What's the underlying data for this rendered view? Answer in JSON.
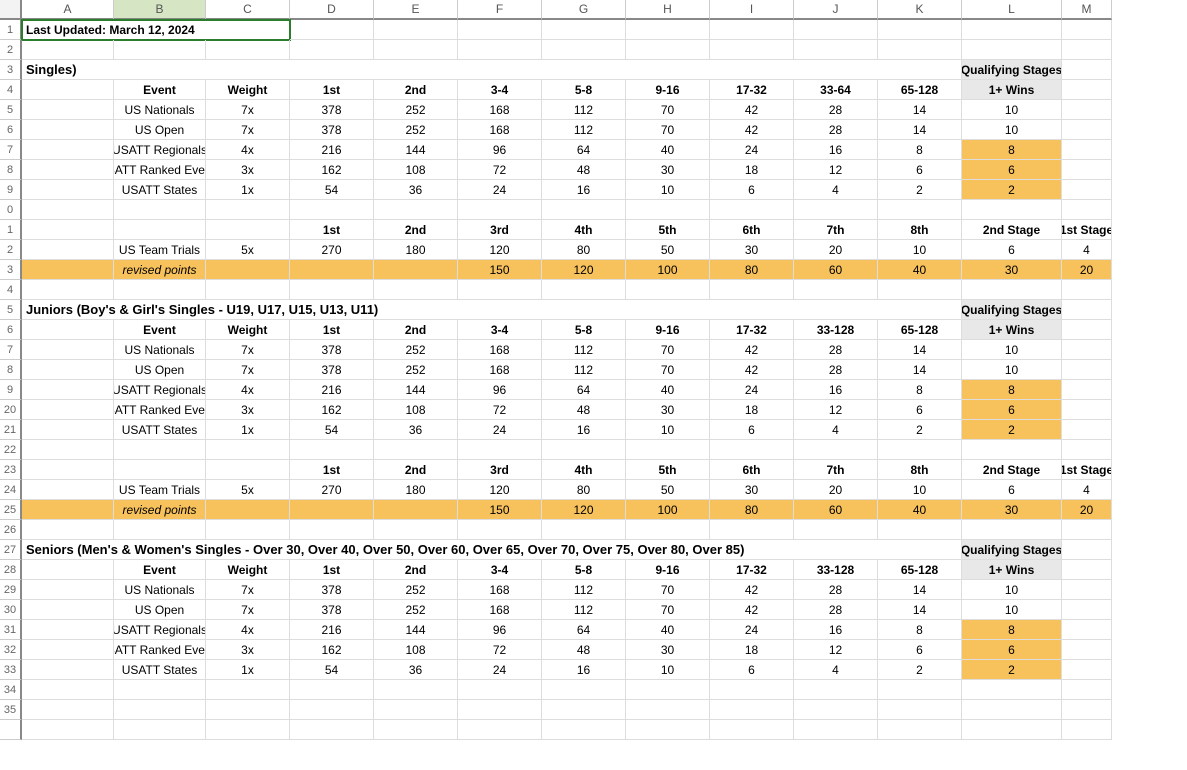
{
  "columns": [
    "A",
    "B",
    "C",
    "D",
    "E",
    "F",
    "G",
    "H",
    "I",
    "J",
    "K",
    "L",
    "M"
  ],
  "row_labels": [
    "1",
    "2",
    "3",
    "4",
    "5",
    "6",
    "7",
    "8",
    "9",
    "0",
    "1",
    "2",
    "3",
    "4",
    "5",
    "6",
    "7",
    "8",
    "9",
    "20",
    "21",
    "22",
    "23",
    "24",
    "25",
    "26",
    "27",
    "28",
    "29",
    "30",
    "31",
    "32",
    "33",
    "34",
    "35"
  ],
  "last_updated": "Last Updated: March 12, 2024",
  "section1": {
    "title": "Singles)",
    "qs_top": "Qualifying Stages",
    "headers": [
      "Event",
      "Weight",
      "1st",
      "2nd",
      "3-4",
      "5-8",
      "9-16",
      "17-32",
      "33-64",
      "65-128",
      "1+ Wins"
    ],
    "rows": [
      {
        "event": "US Nationals",
        "weight": "7x",
        "v": [
          "378",
          "252",
          "168",
          "112",
          "70",
          "42",
          "28",
          "14",
          "10"
        ],
        "hl": false
      },
      {
        "event": "US Open",
        "weight": "7x",
        "v": [
          "378",
          "252",
          "168",
          "112",
          "70",
          "42",
          "28",
          "14",
          "10"
        ],
        "hl": false
      },
      {
        "event": "USATT Regionals",
        "weight": "4x",
        "v": [
          "216",
          "144",
          "96",
          "64",
          "40",
          "24",
          "16",
          "8",
          "8"
        ],
        "hl": true
      },
      {
        "event": "USATT Ranked Events",
        "weight": "3x",
        "v": [
          "162",
          "108",
          "72",
          "48",
          "30",
          "18",
          "12",
          "6",
          "6"
        ],
        "hl": true
      },
      {
        "event": "USATT States",
        "weight": "1x",
        "v": [
          "54",
          "36",
          "24",
          "16",
          "10",
          "6",
          "4",
          "2",
          "2"
        ],
        "hl": true
      }
    ],
    "headers2": [
      "1st",
      "2nd",
      "3rd",
      "4th",
      "5th",
      "6th",
      "7th",
      "8th",
      "2nd Stage",
      "1st Stage"
    ],
    "trials": {
      "event": "US Team Trials",
      "weight": "5x",
      "v": [
        "270",
        "180",
        "120",
        "80",
        "50",
        "30",
        "20",
        "10",
        "6",
        "4"
      ]
    },
    "revised": {
      "label": "revised points",
      "v": [
        "",
        "",
        "150",
        "120",
        "100",
        "80",
        "60",
        "40",
        "30",
        "20"
      ]
    }
  },
  "section2": {
    "title": "Juniors (Boy's & Girl's Singles - U19, U17, U15, U13, U11)",
    "qs_top": "Qualifying Stages",
    "headers": [
      "Event",
      "Weight",
      "1st",
      "2nd",
      "3-4",
      "5-8",
      "9-16",
      "17-32",
      "33-128",
      "65-128",
      "1+ Wins"
    ],
    "rows": [
      {
        "event": "US Nationals",
        "weight": "7x",
        "v": [
          "378",
          "252",
          "168",
          "112",
          "70",
          "42",
          "28",
          "14",
          "10"
        ],
        "hl": false
      },
      {
        "event": "US Open",
        "weight": "7x",
        "v": [
          "378",
          "252",
          "168",
          "112",
          "70",
          "42",
          "28",
          "14",
          "10"
        ],
        "hl": false
      },
      {
        "event": "USATT Regionals",
        "weight": "4x",
        "v": [
          "216",
          "144",
          "96",
          "64",
          "40",
          "24",
          "16",
          "8",
          "8"
        ],
        "hl": true
      },
      {
        "event": "USATT Ranked Events",
        "weight": "3x",
        "v": [
          "162",
          "108",
          "72",
          "48",
          "30",
          "18",
          "12",
          "6",
          "6"
        ],
        "hl": true
      },
      {
        "event": "USATT States",
        "weight": "1x",
        "v": [
          "54",
          "36",
          "24",
          "16",
          "10",
          "6",
          "4",
          "2",
          "2"
        ],
        "hl": true
      }
    ],
    "headers2": [
      "1st",
      "2nd",
      "3rd",
      "4th",
      "5th",
      "6th",
      "7th",
      "8th",
      "2nd Stage",
      "1st Stage"
    ],
    "trials": {
      "event": "US Team Trials",
      "weight": "5x",
      "v": [
        "270",
        "180",
        "120",
        "80",
        "50",
        "30",
        "20",
        "10",
        "6",
        "4"
      ]
    },
    "revised": {
      "label": "revised points",
      "v": [
        "",
        "",
        "150",
        "120",
        "100",
        "80",
        "60",
        "40",
        "30",
        "20"
      ]
    }
  },
  "section3": {
    "title": "Seniors (Men's & Women's Singles - Over 30, Over 40, Over 50, Over 60, Over 65, Over 70, Over 75, Over 80, Over 85)",
    "qs_top": "Qualifying Stages",
    "headers": [
      "Event",
      "Weight",
      "1st",
      "2nd",
      "3-4",
      "5-8",
      "9-16",
      "17-32",
      "33-128",
      "65-128",
      "1+ Wins"
    ],
    "rows": [
      {
        "event": "US Nationals",
        "weight": "7x",
        "v": [
          "378",
          "252",
          "168",
          "112",
          "70",
          "42",
          "28",
          "14",
          "10"
        ],
        "hl": false
      },
      {
        "event": "US Open",
        "weight": "7x",
        "v": [
          "378",
          "252",
          "168",
          "112",
          "70",
          "42",
          "28",
          "14",
          "10"
        ],
        "hl": false
      },
      {
        "event": "USATT Regionals",
        "weight": "4x",
        "v": [
          "216",
          "144",
          "96",
          "64",
          "40",
          "24",
          "16",
          "8",
          "8"
        ],
        "hl": true
      },
      {
        "event": "USATT Ranked Events",
        "weight": "3x",
        "v": [
          "162",
          "108",
          "72",
          "48",
          "30",
          "18",
          "12",
          "6",
          "6"
        ],
        "hl": true
      },
      {
        "event": "USATT States",
        "weight": "1x",
        "v": [
          "54",
          "36",
          "24",
          "16",
          "10",
          "6",
          "4",
          "2",
          "2"
        ],
        "hl": true
      }
    ]
  }
}
